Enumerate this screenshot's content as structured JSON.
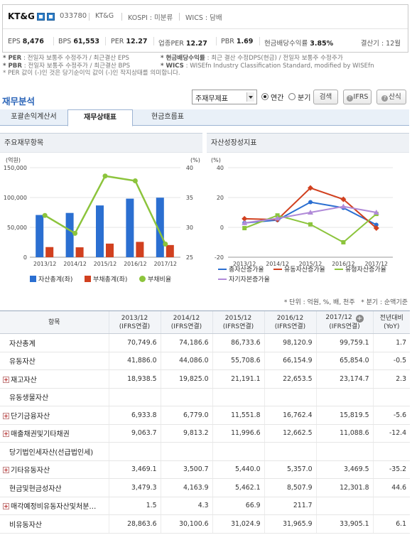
{
  "company": {
    "name": "KT&G",
    "code": "033780",
    "name_short": "KT&G",
    "market": "KOSPI : 미분류",
    "wics": "WICS : 담배"
  },
  "stats": [
    {
      "label": "EPS",
      "value": "8,476"
    },
    {
      "label": "BPS",
      "value": "61,553"
    },
    {
      "label": "PER",
      "value": "12.27"
    },
    {
      "label": "업종PER",
      "value": "12.27"
    },
    {
      "label": "PBR",
      "value": "1.69"
    },
    {
      "label": "현금배당수익률",
      "value": "3.85%"
    }
  ],
  "settlement": "결산기 : 12월",
  "notes": {
    "line1_a_key": "* PER",
    "line1_a": ": 전일자 보통주 수정주가 / 최근결산 EPS",
    "line1_b_key": "* 현금배당수익률",
    "line1_b": ": 최근 결산 수정DPS(현금) / 전일자 보통주 수정주가",
    "line2_a_key": "* PBR",
    "line2_a": ": 전일자 보통주 수정주가 / 최근결산 BPS",
    "line2_b_key": "* WICS",
    "line2_b": ": WISEfn Industry Classification Standard, modified by WISEfn",
    "line3": "* PER 값이 (-)인 것은 당기순이익 값이 (-)인 작지상태를 의미합니다."
  },
  "section": {
    "title": "재무분석",
    "select_value": "주재무제표",
    "radio_annual": "연간",
    "radio_quarter": "분기",
    "search_btn": "검색",
    "ifrs_btn": "IFRS",
    "formula_btn": "산식"
  },
  "tabs": [
    "포괄손익계산서",
    "재무상태표",
    "현금흐름표"
  ],
  "panels": {
    "left_title": "주요재무항목",
    "right_title": "자산성장성지표"
  },
  "colors": {
    "assets": "#2b6fd1",
    "debt": "#d1401f",
    "ratio": "#8cc43c",
    "total_growth": "#2b6fd1",
    "current_growth": "#d1401f",
    "tangible_growth": "#8cc43c",
    "equity_growth": "#b08ad8"
  },
  "chart_data": [
    {
      "type": "bar",
      "categories": [
        "2013/12",
        "2014/12",
        "2015/12",
        "2016/12",
        "2017/12"
      ],
      "y_unit_left": "(억원)",
      "y_unit_right": "(%)",
      "ylim": [
        0,
        150000
      ],
      "y2lim": [
        25,
        40
      ],
      "yticks": [
        "150,000",
        "100,000",
        "50,000",
        "0"
      ],
      "y2ticks": [
        "40",
        "35",
        "30",
        "25"
      ],
      "series": [
        {
          "name": "자산총계(좌)",
          "type": "bar",
          "values": [
            70749.6,
            74186.6,
            86733.6,
            98120.9,
            99759.1
          ]
        },
        {
          "name": "부채총계(좌)",
          "type": "bar",
          "values": [
            17000,
            16600,
            22800,
            25700,
            20400
          ]
        },
        {
          "name": "부채비율",
          "type": "line",
          "axis": "right",
          "values": [
            32.0,
            29.0,
            38.6,
            37.8,
            27.2
          ]
        }
      ]
    },
    {
      "type": "line",
      "categories": [
        "2013/12",
        "2014/12",
        "2015/12",
        "2016/12",
        "2017/12"
      ],
      "y_unit": "(%)",
      "ylim": [
        -20,
        40
      ],
      "yticks": [
        "40",
        "20",
        "0",
        "-20"
      ],
      "series": [
        {
          "name": "총자산증가율",
          "values": [
            3.0,
            4.9,
            16.9,
            13.1,
            1.7
          ]
        },
        {
          "name": "유동자산증가율",
          "values": [
            5.8,
            5.2,
            26.4,
            18.8,
            -0.5
          ]
        },
        {
          "name": "유형자산증가율",
          "values": [
            -0.5,
            8.0,
            2.0,
            -10.0,
            9.0
          ]
        },
        {
          "name": "자기자본증가율",
          "values": [
            3.0,
            6.0,
            10.0,
            14.0,
            10.0
          ]
        }
      ]
    }
  ],
  "table": {
    "unit_note": "* 단위 : 억원, %, 배, 천주",
    "quarter_note": "* 분기 : 순액기준",
    "head": {
      "item": "항목",
      "cols": [
        [
          "2013/12",
          "(IFRS연결)"
        ],
        [
          "2014/12",
          "(IFRS연결)"
        ],
        [
          "2015/12",
          "(IFRS연결)"
        ],
        [
          "2016/12",
          "(IFRS연결)"
        ],
        [
          "2017/12",
          "(IFRS연결)"
        ]
      ],
      "yoy": [
        "전년대비",
        "(YoY)"
      ]
    },
    "rows": [
      {
        "label": "자산총계",
        "expand": false,
        "values": [
          "70,749.6",
          "74,186.6",
          "86,733.6",
          "98,120.9",
          "99,759.1"
        ],
        "yoy": "1.7",
        "neg": false
      },
      {
        "label": "유동자산",
        "expand": false,
        "values": [
          "41,886.0",
          "44,086.0",
          "55,708.6",
          "66,154.9",
          "65,854.0"
        ],
        "yoy": "-0.5",
        "neg": true
      },
      {
        "label": "재고자산",
        "expand": true,
        "values": [
          "18,938.5",
          "19,825.0",
          "21,191.1",
          "22,653.5",
          "23,174.7"
        ],
        "yoy": "2.3",
        "neg": false
      },
      {
        "label": "유동생물자산",
        "expand": false,
        "values": [
          "",
          "",
          "",
          "",
          ""
        ],
        "yoy": "",
        "neg": false
      },
      {
        "label": "단기금융자산",
        "expand": true,
        "values": [
          "6,933.8",
          "6,779.0",
          "11,551.8",
          "16,762.4",
          "15,819.5"
        ],
        "yoy": "-5.6",
        "neg": true
      },
      {
        "label": "매출채권및기타채권",
        "expand": true,
        "values": [
          "9,063.7",
          "9,813.2",
          "11,996.6",
          "12,662.5",
          "11,088.6"
        ],
        "yoy": "-12.4",
        "neg": true
      },
      {
        "label": "당기법인세자산(선급법인세)",
        "expand": false,
        "values": [
          "",
          "",
          "",
          "",
          ""
        ],
        "yoy": "",
        "neg": false
      },
      {
        "label": "기타유동자산",
        "expand": true,
        "values": [
          "3,469.1",
          "3,500.7",
          "5,440.0",
          "5,357.0",
          "3,469.5"
        ],
        "yoy": "-35.2",
        "neg": true
      },
      {
        "label": "현금및현금성자산",
        "expand": false,
        "values": [
          "3,479.3",
          "4,163.9",
          "5,462.1",
          "8,507.9",
          "12,301.8"
        ],
        "yoy": "44.6",
        "neg": false
      },
      {
        "label": "매각예정비유동자산및처분…",
        "expand": true,
        "values": [
          "1.5",
          "4.3",
          "66.9",
          "211.7",
          ""
        ],
        "yoy": "",
        "neg": false
      },
      {
        "label": "비유동자산",
        "expand": false,
        "values": [
          "28,863.6",
          "30,100.6",
          "31,024.9",
          "31,965.9",
          "33,905.1"
        ],
        "yoy": "6.1",
        "neg": false
      }
    ]
  }
}
